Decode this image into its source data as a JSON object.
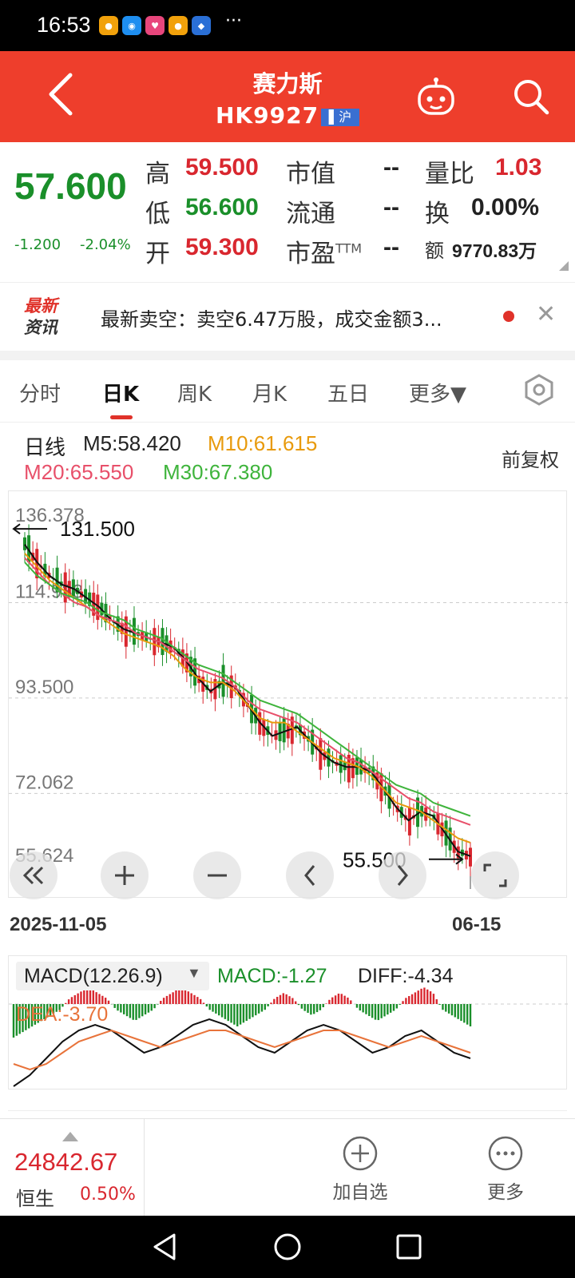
{
  "status_bar": {
    "time": "16:53",
    "more": "···"
  },
  "header": {
    "name": "赛力斯",
    "code": "HK9927",
    "badge": "沪"
  },
  "quote": {
    "price": "57.600",
    "change": "-1.200",
    "change_pct": "-2.04%",
    "fields": [
      {
        "label": "高",
        "value": "59.500",
        "color": "red"
      },
      {
        "label": "低",
        "value": "56.600",
        "color": "grn"
      },
      {
        "label": "开",
        "value": "59.300",
        "color": "red"
      },
      {
        "label": "市值",
        "value": "--",
        "color": "blk"
      },
      {
        "label": "流通",
        "value": "--",
        "color": "blk"
      },
      {
        "label": "市盈",
        "value": "--",
        "color": "blk",
        "label_suffix": "TTM"
      },
      {
        "label": "量比",
        "value": "1.03",
        "color": "red"
      },
      {
        "label": "换",
        "value": "0.00%",
        "color": "blk"
      },
      {
        "label": "额",
        "value": "9770.83万",
        "color": "blk"
      }
    ]
  },
  "news": {
    "logo_line1": "最新",
    "logo_line2": "资讯",
    "text": "最新卖空：卖空6.47万股，成交金额3..."
  },
  "tabs": [
    "分时",
    "日K",
    "周K",
    "月K",
    "五日",
    "更多▼"
  ],
  "active_tab": "日K",
  "ma_legend": {
    "period": "日线",
    "m5": "M5:58.420",
    "m10": "M10:61.615",
    "m20": "M20:65.550",
    "m30": "M30:67.380",
    "adjust": "前复权",
    "colors": {
      "m5": "#111111",
      "m10": "#e89a0c",
      "m20": "#e8506a",
      "m30": "#3fb43c"
    }
  },
  "chart_data": {
    "type": "candlestick",
    "y_ticks": [
      "136.378",
      "114.938",
      "93.500",
      "72.062",
      "55.624"
    ],
    "ylim": [
      55.624,
      136.378
    ],
    "max_label": "131.500",
    "min_label": "55.500",
    "x_start": "2025-11-05",
    "x_end": "06-15",
    "ma5": [
      128,
      124,
      121,
      119,
      118,
      116,
      114,
      111,
      109,
      108,
      107,
      106,
      105,
      102,
      98,
      95,
      97,
      96,
      92,
      88,
      85,
      86,
      87,
      84,
      81,
      79,
      78,
      78,
      77,
      73,
      69,
      66,
      68,
      67,
      63,
      59,
      58
    ],
    "ma10": [
      126,
      123,
      120,
      118,
      116,
      114,
      112,
      110,
      108,
      107,
      106,
      105,
      103,
      100,
      98,
      97,
      97,
      95,
      92,
      89,
      88,
      88,
      86,
      84,
      82,
      80,
      79,
      78,
      76,
      73,
      70,
      69,
      68,
      66,
      64,
      62,
      61
    ],
    "ma20": [
      125,
      122,
      119,
      117,
      115,
      114,
      112,
      111,
      110,
      108,
      107,
      106,
      104,
      102,
      100,
      99,
      98,
      96,
      93,
      91,
      90,
      89,
      88,
      86,
      84,
      82,
      80,
      79,
      77,
      75,
      73,
      71,
      70,
      68,
      67,
      66,
      65
    ],
    "ma30": [
      124,
      121,
      119,
      117,
      116,
      115,
      113,
      112,
      111,
      109,
      108,
      107,
      105,
      103,
      101,
      100,
      99,
      97,
      95,
      93,
      92,
      91,
      90,
      88,
      86,
      84,
      82,
      80,
      78,
      76,
      74,
      73,
      72,
      70,
      69,
      68,
      67
    ]
  },
  "macd": {
    "selector": "MACD(12.26.9)",
    "macd": "MACD:-1.27",
    "diff": "DIFF:-4.34",
    "dea": "DEA:-3.70",
    "histogram": [
      -6,
      -5,
      -4,
      -3,
      -2,
      -1,
      1,
      2,
      3,
      2,
      1,
      -1,
      -2,
      -3,
      -2,
      -1,
      1,
      2,
      3,
      2,
      1,
      -1,
      -2,
      -3,
      -4,
      -3,
      -2,
      -1,
      1,
      2,
      1,
      -1,
      -2,
      -1,
      1,
      2,
      1,
      -1,
      -2,
      -3,
      -2,
      -1,
      1,
      2,
      3,
      2,
      -1,
      -2,
      -3,
      -4
    ],
    "diff_line": [
      -9,
      -7,
      -4,
      -1,
      1,
      2,
      1,
      -1,
      -3,
      -2,
      0,
      2,
      3,
      2,
      0,
      -2,
      -3,
      -1,
      1,
      2,
      1,
      -1,
      -3,
      -2,
      0,
      1,
      -1,
      -3,
      -4
    ],
    "dea_line": [
      -5,
      -6,
      -5,
      -3,
      -1,
      0,
      1,
      0,
      -1,
      -2,
      -1,
      0,
      1,
      1,
      0,
      -1,
      -2,
      -1,
      0,
      1,
      1,
      0,
      -1,
      -2,
      -1,
      0,
      -1,
      -2,
      -3
    ]
  },
  "bottom_bar": {
    "index_value": "24842.67",
    "index_name": "恒生",
    "index_change": "0.50%",
    "add_watch": "加自选",
    "more": "更多"
  }
}
